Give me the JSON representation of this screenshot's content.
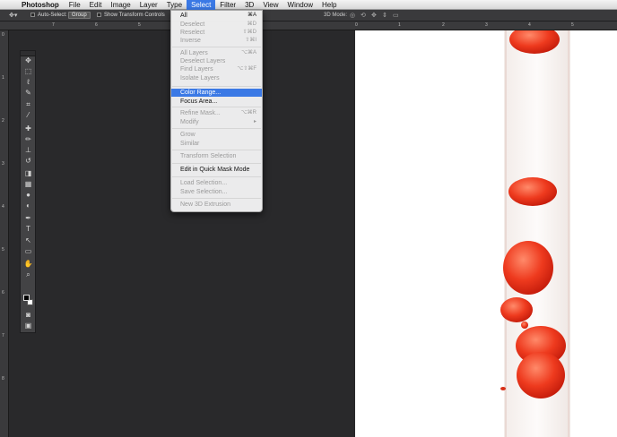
{
  "menubar": {
    "app_name": "Photoshop",
    "items": [
      "File",
      "Edit",
      "Image",
      "Layer",
      "Type",
      "Select",
      "Filter",
      "3D",
      "View",
      "Window",
      "Help"
    ],
    "active_item": "Select"
  },
  "options_bar": {
    "auto_select_label": "Auto-Select:",
    "auto_select_value": "Group",
    "show_transform_label": "Show Transform Controls",
    "mode_3d_label": "3D Mode:"
  },
  "rulers": {
    "h_ticks": [
      "7",
      "6",
      "5",
      "0",
      "1",
      "2",
      "3",
      "4",
      "5"
    ],
    "v_ticks": [
      "0",
      "1",
      "2",
      "3",
      "4",
      "5",
      "6",
      "7",
      "8"
    ]
  },
  "select_menu": {
    "items": [
      {
        "label": "All",
        "shortcut": "⌘A",
        "enabled": true
      },
      {
        "label": "Deselect",
        "shortcut": "⌘D",
        "enabled": false
      },
      {
        "label": "Reselect",
        "shortcut": "⇧⌘D",
        "enabled": false
      },
      {
        "label": "Inverse",
        "shortcut": "⇧⌘I",
        "enabled": false
      },
      {
        "label": "All Layers",
        "shortcut": "⌥⌘A",
        "enabled": false
      },
      {
        "label": "Deselect Layers",
        "shortcut": "",
        "enabled": false
      },
      {
        "label": "Find Layers",
        "shortcut": "⌥⇧⌘F",
        "enabled": false
      },
      {
        "label": "Isolate Layers",
        "shortcut": "",
        "enabled": false
      },
      {
        "label": "Color Range...",
        "shortcut": "",
        "enabled": true,
        "highlighted": true
      },
      {
        "label": "Focus Area...",
        "shortcut": "",
        "enabled": true
      },
      {
        "label": "Refine Mask...",
        "shortcut": "⌥⌘R",
        "enabled": false
      },
      {
        "label": "Modify",
        "shortcut": "▸",
        "enabled": false
      },
      {
        "label": "Grow",
        "shortcut": "",
        "enabled": false
      },
      {
        "label": "Similar",
        "shortcut": "",
        "enabled": false
      },
      {
        "label": "Transform Selection",
        "shortcut": "",
        "enabled": false
      },
      {
        "label": "Edit in Quick Mask Mode",
        "shortcut": "",
        "enabled": true
      },
      {
        "label": "Load Selection...",
        "shortcut": "",
        "enabled": false
      },
      {
        "label": "Save Selection...",
        "shortcut": "",
        "enabled": false
      },
      {
        "label": "New 3D Extrusion",
        "shortcut": "",
        "enabled": false
      }
    ]
  },
  "toolbar": {
    "tools": [
      "move-tool",
      "marquee-tool",
      "lasso-tool",
      "quick-selection-tool",
      "crop-tool",
      "eyedropper-tool",
      "healing-brush-tool",
      "brush-tool",
      "clone-stamp-tool",
      "history-brush-tool",
      "eraser-tool",
      "gradient-tool",
      "blur-tool",
      "dodge-tool",
      "pen-tool",
      "type-tool",
      "path-selection-tool",
      "rectangle-tool",
      "hand-tool",
      "zoom-tool"
    ],
    "tool_glyphs": [
      "✥",
      "⬚",
      "ℓ",
      "✎",
      "⌗",
      "⁄",
      "✚",
      "✏",
      "⊥",
      "↺",
      "◨",
      "▦",
      "●",
      "◐",
      "✒",
      "T",
      "↖",
      "▭",
      "✋",
      "⌕"
    ]
  },
  "colors": {
    "accent": "#3b79e5",
    "drop_red": "#e8321c"
  }
}
